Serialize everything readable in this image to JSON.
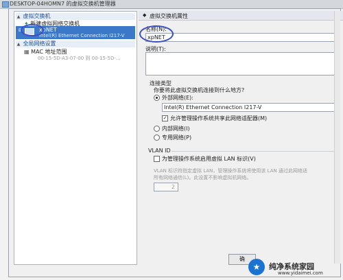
{
  "window": {
    "title": "DESKTOP-04HOMN7 的虚拟交换机管理器"
  },
  "left": {
    "section1": "虚拟交换机",
    "new_switch": "新建虚拟网络交换机",
    "selected": {
      "name": "xpNET",
      "sub": "Intel(R) Ethernet Connection I217-V"
    },
    "section2": "全局网络设置",
    "mac": {
      "title": "MAC 地址范围",
      "range": "00-15-5D-A3-07-00 到 00-15-5D-..."
    }
  },
  "right": {
    "header": "虚拟交换机属性",
    "name_label": "名称(N):",
    "name_value": "xpNET",
    "notes_label": "说明(T):",
    "conn_type": "连接类型",
    "conn_question": "你要将此虚拟交换机连接到什么地方?",
    "external": "外部网络(E):",
    "adapter": "Intel(R) Ethernet Connection I217-V",
    "allow_share": "允许管理操作系统共享此网络适配器(M)",
    "internal": "内部网络(I)",
    "private": "专用网络(P)",
    "vlan_title": "VLAN ID",
    "vlan_enable": "为管理操作系统启用虚拟 LAN 标识(V)",
    "vlan_desc1": "VLAN 标识符指定虚拟 LAN，管理操作系统将使用该 LAN 通过此网络适",
    "vlan_desc2": "所有网络通信(L)。此设置不影响虚拟机网络。",
    "vlan_value": "2"
  },
  "buttons": {
    "ok": "确"
  },
  "watermark": {
    "logo": "★",
    "text": "纯净系统家园",
    "url": "www.yidaimei.com"
  }
}
